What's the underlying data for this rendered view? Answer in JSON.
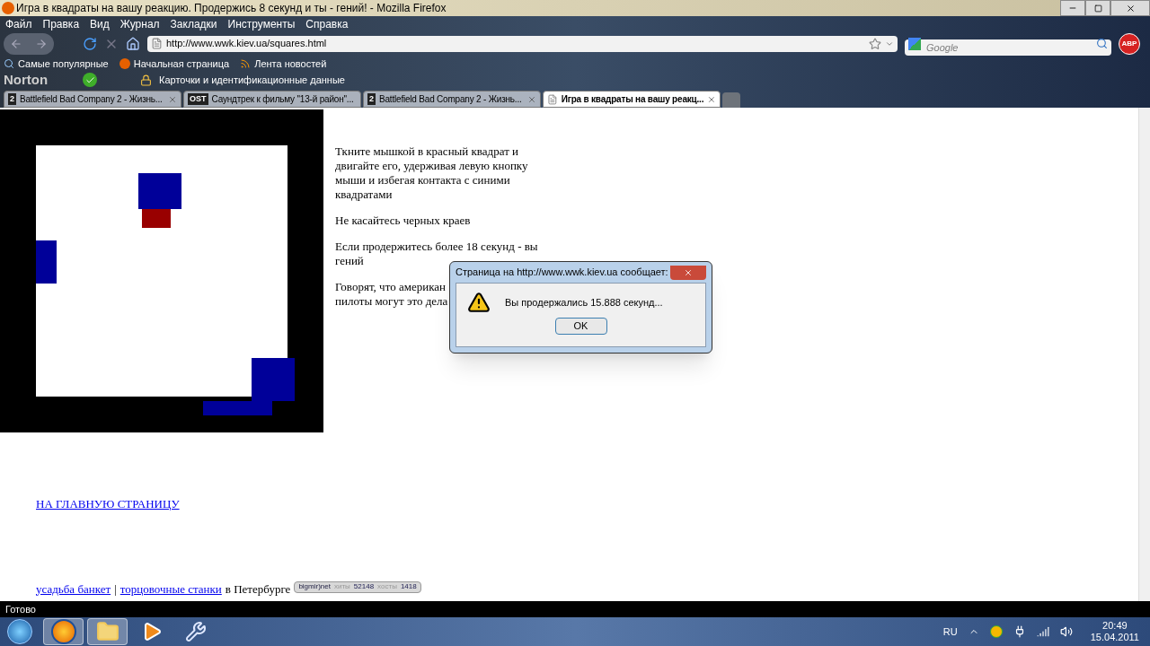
{
  "window": {
    "title": "Игра в квадраты на вашу реакцию. Продержись 8 секунд и ты - гений! - Mozilla Firefox"
  },
  "menu": [
    "Файл",
    "Правка",
    "Вид",
    "Журнал",
    "Закладки",
    "Инструменты",
    "Справка"
  ],
  "navigation": {
    "url": "http://www.wwk.kiev.ua/squares.html",
    "search_placeholder": "Google",
    "adblock_label": "ABP"
  },
  "bookmarks": [
    "Самые популярные",
    "Начальная страница",
    "Лента новостей"
  ],
  "norton_toolbar": {
    "logo": "Norton",
    "identity_label": "Карточки и идентификационные данные"
  },
  "tabs": [
    {
      "badge": "2",
      "title": "Battlefield Bad Company 2 - Жизнь...",
      "selected": false
    },
    {
      "badge": "OST",
      "title": "Саундтрек к фильму \"13-й район\"...",
      "selected": false
    },
    {
      "badge": "2",
      "title": "Battlefield Bad Company 2 - Жизнь...",
      "selected": false
    },
    {
      "title": "Игра в квадраты на вашу реакц...",
      "selected": true
    }
  ],
  "page": {
    "paragraphs": [
      [
        "Ткните мышкой в красный квадрат и двигайте его, удерживая левую кнопку мыши и избегая контакта с синими квадратами"
      ],
      [
        "Не касайтесь черных краев"
      ],
      [
        "Если продержитесь более 18 секунд - вы гений"
      ],
      [
        "Говорят, что американ",
        "пилоты могут это дела"
      ]
    ],
    "home_link": "НА ГЛАВНУЮ СТРАНИЦУ",
    "footer": {
      "links": [
        "усадьба банкет",
        "торцовочные станки"
      ],
      "separator": "|",
      "suffix": "в Петербурге"
    },
    "counter": {
      "brand": "bigmir)net",
      "hits_label": "хиты",
      "hits": "52148",
      "hosts_label": "хосты",
      "hosts": "1418"
    }
  },
  "dialog": {
    "title": "Страница на http://www.wwk.kiev.ua сообщает:",
    "message": "Вы продержались 15.888 секунд...",
    "button": "OK"
  },
  "status_bar": "Готово",
  "taskbar": {
    "apps": [
      {
        "kind": "firefox",
        "selected": true
      },
      {
        "kind": "folder",
        "selected": true
      },
      {
        "kind": "media",
        "selected": false
      },
      {
        "kind": "tool",
        "selected": false
      }
    ],
    "language": "RU",
    "time": "20:49",
    "date": "15.04.2011"
  }
}
